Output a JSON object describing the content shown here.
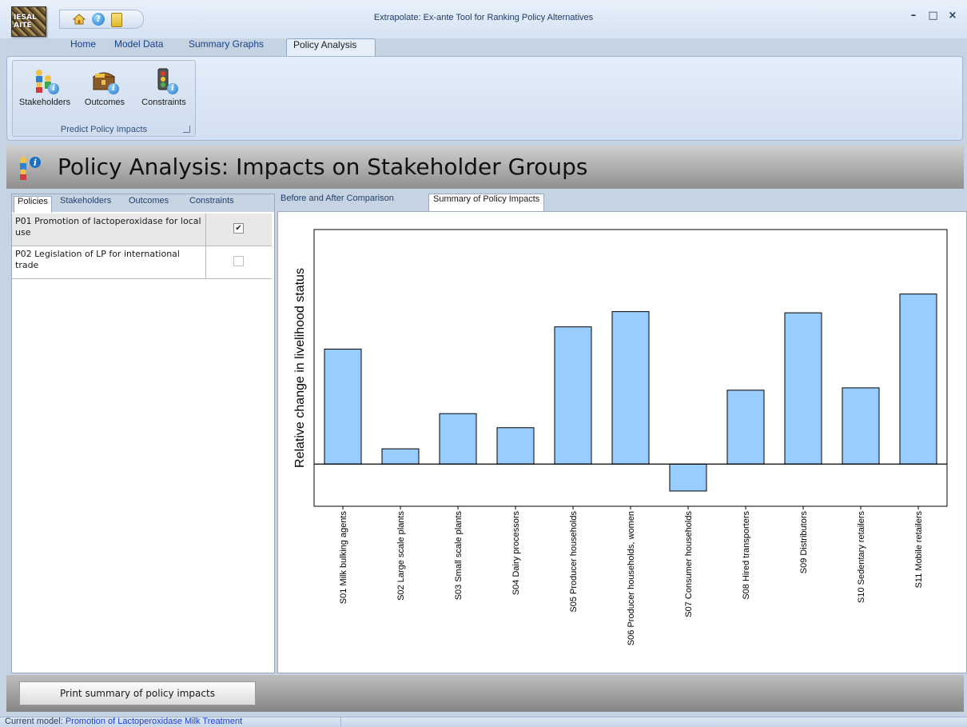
{
  "window": {
    "title": "Extrapolate: Ex-ante Tool for Ranking Policy Alternatives",
    "logo_text": "IESAL AITE"
  },
  "window_controls": {
    "minimize": "–",
    "maximize": "□",
    "close": "×"
  },
  "quick_access": {
    "help_glyph": "?"
  },
  "ribbon": {
    "tabs": [
      {
        "label": "Home"
      },
      {
        "label": "Model Data"
      },
      {
        "label": "Summary Graphs"
      },
      {
        "label": "Policy Analysis",
        "active": true
      }
    ],
    "group_label": "Predict Policy Impacts",
    "buttons": [
      {
        "label": "Stakeholders",
        "icon": "stakeholders-info-icon"
      },
      {
        "label": "Outcomes",
        "icon": "treasure-chest-info-icon"
      },
      {
        "label": "Constraints",
        "icon": "traffic-light-info-icon"
      }
    ],
    "badge_glyph": "i"
  },
  "header": {
    "title": "Policy Analysis: Impacts on Stakeholder Groups"
  },
  "left_tabs": [
    {
      "label": "Policies",
      "active": true
    },
    {
      "label": "Stakeholders"
    },
    {
      "label": "Outcomes"
    },
    {
      "label": "Constraints"
    }
  ],
  "policies": [
    {
      "name": "P01 Promotion of lactoperoxidase for local use",
      "checked": true,
      "check_glyph": "✔"
    },
    {
      "name": "P02 Legislation of LP for international trade",
      "checked": false,
      "check_glyph": ""
    }
  ],
  "right_tabs": [
    {
      "label": "Before and After Comparison"
    },
    {
      "label": "Summary of Policy Impacts",
      "active": true
    }
  ],
  "colors": {
    "bar_fill": "#99ccff",
    "bar_stroke": "#000000",
    "header_band": "#a9a9a9",
    "ribbon_bg": "#dbe6f4"
  },
  "chart_data": {
    "type": "bar",
    "ylabel": "Relative change in livelihood status",
    "xlabel": "",
    "categories": [
      "S01 Milk bulking agents",
      "S02 Large scale plants",
      "S03 Small scale plants",
      "S04 Dairy processors",
      "S05 Producer households",
      "S06 Producer households, women",
      "S07 Consumer households",
      "S08 Hired transporters",
      "S09 Distributors",
      "S10 Sedentary retailers",
      "S11 Mobile retailers"
    ],
    "values": [
      0.49,
      0.065,
      0.215,
      0.155,
      0.585,
      0.65,
      -0.115,
      0.315,
      0.645,
      0.325,
      0.725
    ],
    "ylim": [
      -0.18,
      1.0
    ],
    "grid": false,
    "legend": "none",
    "y_ticks_labeled": false
  },
  "bottom": {
    "print_button": "Print summary of policy impacts"
  },
  "status": {
    "label": "Current model: ",
    "model": "Promotion of Lactoperoxidase Milk Treatment"
  }
}
